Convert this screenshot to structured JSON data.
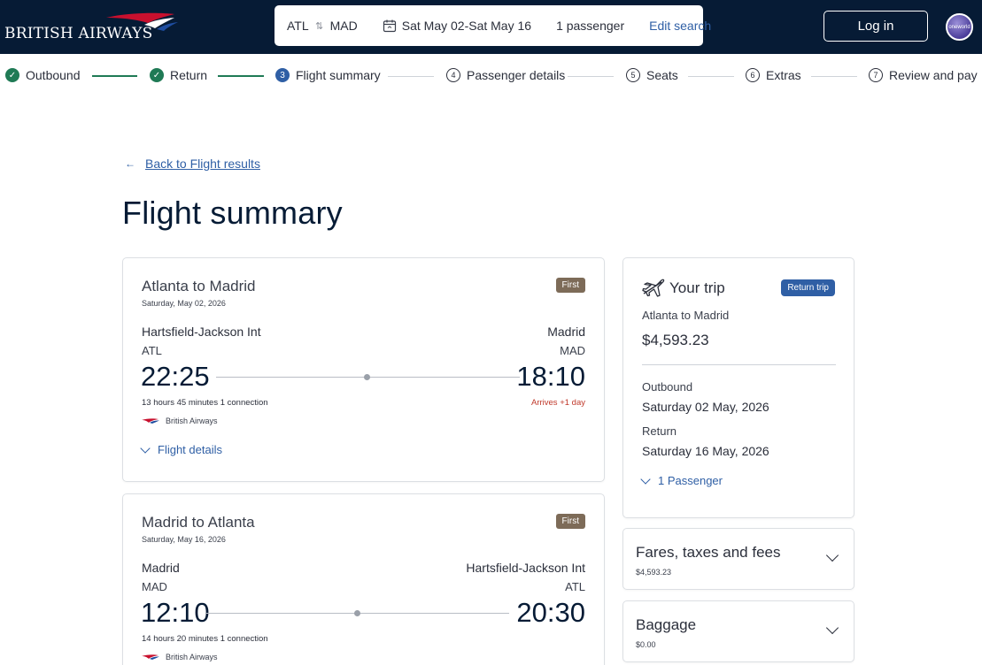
{
  "header": {
    "brand": "BRITISH AIRWAYS",
    "search": {
      "origin": "ATL",
      "destination": "MAD",
      "dates": "Sat May 02-Sat May 16",
      "passengers": "1 passenger",
      "edit_label": "Edit search"
    },
    "login_label": "Log in",
    "alliance_logo": "oneworld"
  },
  "steps": [
    {
      "num": "1",
      "label": "Outbound",
      "state": "done"
    },
    {
      "num": "2",
      "label": "Return",
      "state": "done"
    },
    {
      "num": "3",
      "label": "Flight summary",
      "state": "current"
    },
    {
      "num": "4",
      "label": "Passenger details",
      "state": "todo"
    },
    {
      "num": "5",
      "label": "Seats",
      "state": "todo"
    },
    {
      "num": "6",
      "label": "Extras",
      "state": "todo"
    },
    {
      "num": "7",
      "label": "Review and pay",
      "state": "todo"
    }
  ],
  "back_link": "Back to Flight results",
  "page_title": "Flight summary",
  "flights": [
    {
      "route": "Atlanta to Madrid",
      "date": "Saturday, May 02, 2026",
      "cabin": "First",
      "dep_airport": "Hartsfield-Jackson Int",
      "arr_airport": "Madrid",
      "dep_code": "ATL",
      "arr_code": "MAD",
      "dep_time": "22:25",
      "arr_time": "18:10",
      "duration": "13 hours 45 minutes   1 connection",
      "arrives_note": "Arrives +1 day",
      "airline": "British Airways",
      "details_label": "Flight details"
    },
    {
      "route": "Madrid to Atlanta",
      "date": "Saturday, May 16, 2026",
      "cabin": "First",
      "dep_airport": "Madrid",
      "arr_airport": "Hartsfield-Jackson Int",
      "dep_code": "MAD",
      "arr_code": "ATL",
      "dep_time": "12:10",
      "arr_time": "20:30",
      "duration": "14 hours 20 minutes   1 connection",
      "airline": "British Airways"
    }
  ],
  "trip": {
    "title": "Your trip",
    "badge": "Return trip",
    "route": "Atlanta to Madrid",
    "price": "$4,593.23",
    "outbound_label": "Outbound",
    "outbound_date": "Saturday 02 May, 2026",
    "return_label": "Return",
    "return_date": "Saturday 16 May, 2026",
    "passengers_label": "1 Passenger"
  },
  "fares": {
    "title": "Fares, taxes and fees",
    "amount": "$4,593.23"
  },
  "baggage": {
    "title": "Baggage",
    "amount": "$0.00"
  },
  "colors": {
    "navy": "#061b35",
    "link": "#2f5fa5",
    "done": "#1f7a55",
    "first_badge": "#7d6b58",
    "arrives": "#c0392b"
  }
}
